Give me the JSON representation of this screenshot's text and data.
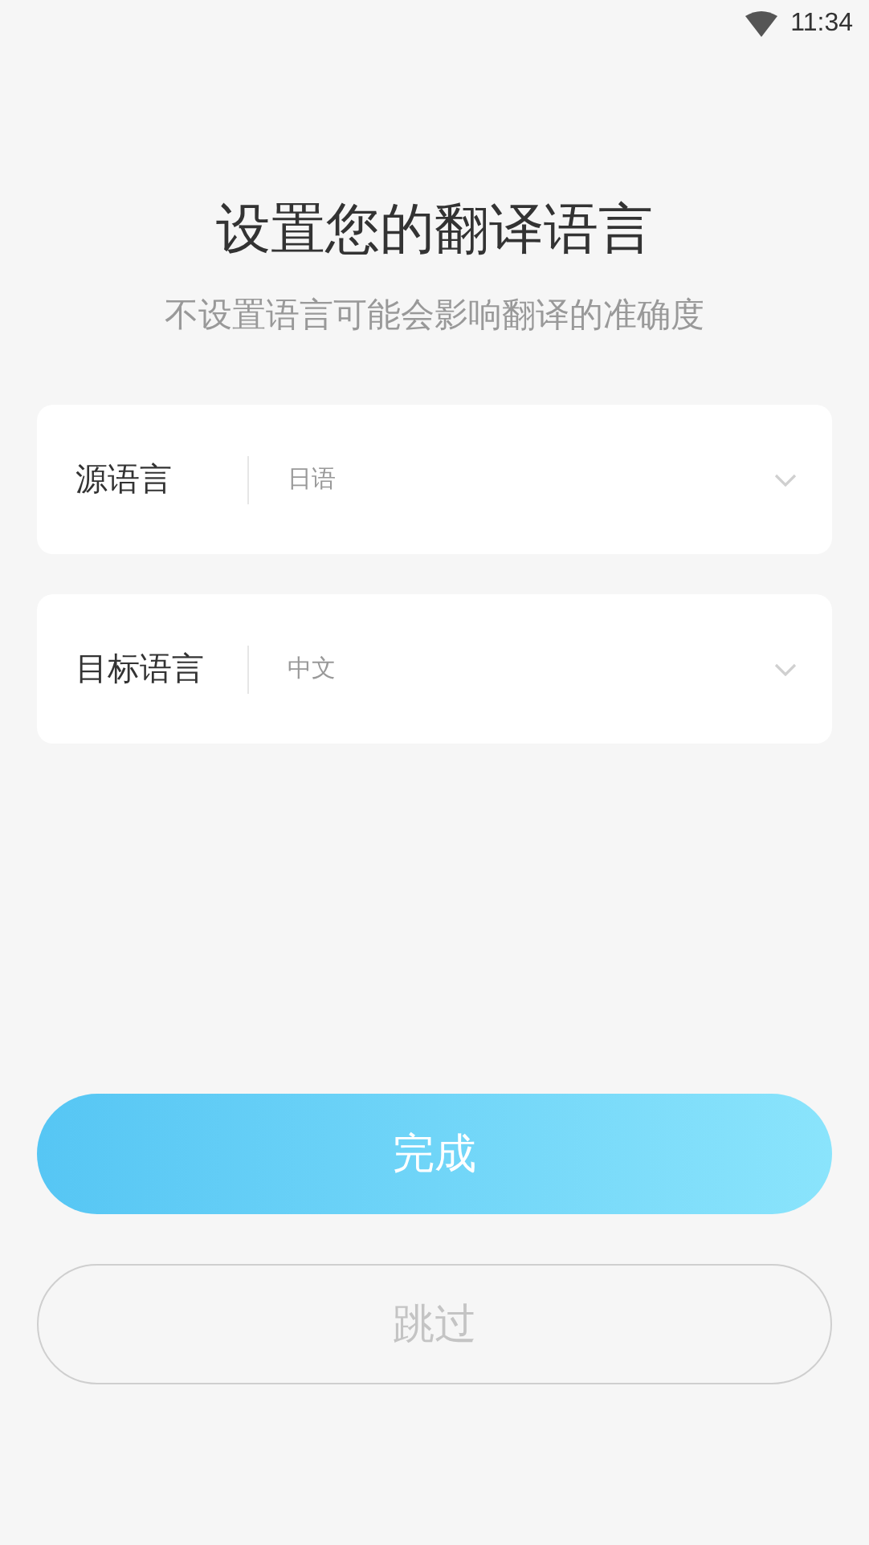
{
  "status_bar": {
    "time": "11:34"
  },
  "title": "设置您的翻译语言",
  "subtitle": "不设置语言可能会影响翻译的准确度",
  "language_pickers": [
    {
      "label": "源语言",
      "value": "日语"
    },
    {
      "label": "目标语言",
      "value": "中文"
    }
  ],
  "buttons": [
    {
      "label": "完成",
      "kind": "primary"
    },
    {
      "label": "跳过",
      "kind": "secondary"
    }
  ]
}
